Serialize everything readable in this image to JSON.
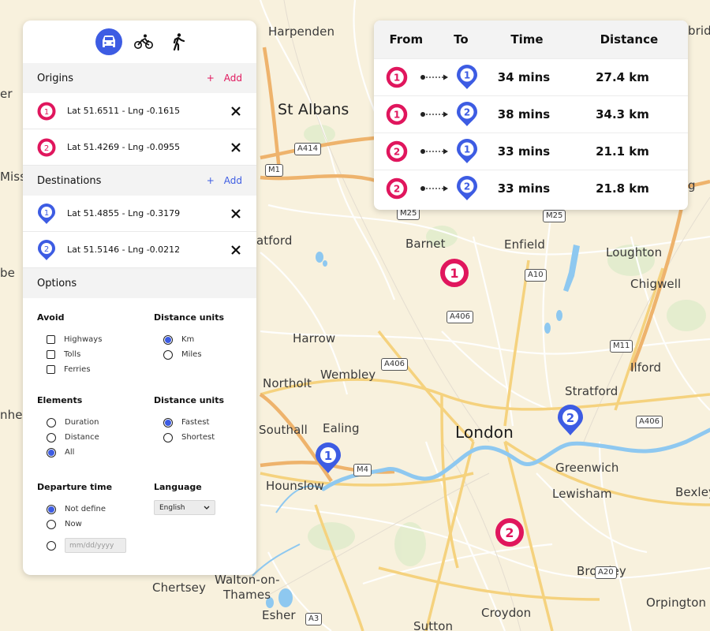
{
  "travel_modes": [
    {
      "name": "car",
      "icon": "car-icon",
      "active": true
    },
    {
      "name": "bicycle",
      "icon": "bicycle-icon",
      "active": false
    },
    {
      "name": "walking",
      "icon": "walking-icon",
      "active": false
    }
  ],
  "colors": {
    "origin": "#e0165d",
    "destination": "#3d5ce3",
    "accent": "#3d5ce3"
  },
  "origins": {
    "title": "Origins",
    "add_plus": "+",
    "add_label": "Add",
    "items": [
      {
        "number": "1",
        "label": "Lat 51.6511 - Lng -0.1615"
      },
      {
        "number": "2",
        "label": "Lat 51.4269 - Lng -0.0955"
      }
    ]
  },
  "destinations": {
    "title": "Destinations",
    "add_plus": "+",
    "add_label": "Add",
    "items": [
      {
        "number": "1",
        "label": "Lat 51.4855 - Lng -0.3179"
      },
      {
        "number": "2",
        "label": "Lat 51.5146 - Lng -0.0212"
      }
    ]
  },
  "options": {
    "title": "Options",
    "avoid": {
      "title": "Avoid",
      "items": [
        {
          "label": "Highways",
          "checked": false
        },
        {
          "label": "Tolls",
          "checked": false
        },
        {
          "label": "Ferries",
          "checked": false
        }
      ]
    },
    "distance_units": {
      "title": "Distance units",
      "items": [
        {
          "label": "Km",
          "selected": true
        },
        {
          "label": "Miles",
          "selected": false
        }
      ]
    },
    "elements": {
      "title": "Elements",
      "items": [
        {
          "label": "Duration",
          "selected": false
        },
        {
          "label": "Distance",
          "selected": false
        },
        {
          "label": "All",
          "selected": true
        }
      ]
    },
    "route_type": {
      "title": "Distance units",
      "items": [
        {
          "label": "Fastest",
          "selected": true
        },
        {
          "label": "Shortest",
          "selected": false
        }
      ]
    },
    "departure_time": {
      "title": "Departure time",
      "items": [
        {
          "label": "Not define",
          "selected": true
        },
        {
          "label": "Now",
          "selected": false
        }
      ],
      "date_placeholder": "mm/dd/yyyy",
      "date_selected": false
    },
    "language": {
      "title": "Language",
      "selected": "English"
    }
  },
  "results": {
    "headers": {
      "from": "From",
      "to": "To",
      "time": "Time",
      "distance": "Distance"
    },
    "rows": [
      {
        "from": "1",
        "to": "1",
        "time": "34 mins",
        "distance": "27.4 km"
      },
      {
        "from": "1",
        "to": "2",
        "time": "38 mins",
        "distance": "34.3 km"
      },
      {
        "from": "2",
        "to": "1",
        "time": "33 mins",
        "distance": "21.1 km"
      },
      {
        "from": "2",
        "to": "2",
        "time": "33 mins",
        "distance": "21.8 km"
      }
    ]
  },
  "map": {
    "places": [
      {
        "name": "Harpenden",
        "size": "normal"
      },
      {
        "name": "St Albans",
        "size": "big"
      },
      {
        "name": "Watford",
        "display": "atford",
        "size": "normal"
      },
      {
        "name": "Barnet",
        "size": "normal"
      },
      {
        "name": "Enfield",
        "size": "normal"
      },
      {
        "name": "Loughton",
        "size": "normal"
      },
      {
        "name": "Chigwell",
        "size": "normal"
      },
      {
        "name": "Harrow",
        "size": "normal"
      },
      {
        "name": "Wembley",
        "size": "normal"
      },
      {
        "name": "Northolt",
        "size": "normal"
      },
      {
        "name": "Ilford",
        "size": "normal"
      },
      {
        "name": "Stratford",
        "size": "normal"
      },
      {
        "name": "Southall",
        "size": "normal"
      },
      {
        "name": "Ealing",
        "size": "normal"
      },
      {
        "name": "London",
        "size": "xl"
      },
      {
        "name": "Hounslow",
        "size": "normal"
      },
      {
        "name": "Greenwich",
        "size": "normal"
      },
      {
        "name": "Lewisham",
        "size": "normal"
      },
      {
        "name": "Bexley",
        "size": "normal"
      },
      {
        "name": "Bromley",
        "size": "normal"
      },
      {
        "name": "Orpington",
        "size": "normal"
      },
      {
        "name": "Croydon",
        "size": "normal"
      },
      {
        "name": "Sutton",
        "size": "normal"
      },
      {
        "name": "Esher",
        "size": "normal"
      },
      {
        "name": "Walton-on-",
        "size": "normal"
      },
      {
        "name": "Thames",
        "size": "normal"
      },
      {
        "name": "Chertsey",
        "size": "normal"
      },
      {
        "name": "Hemel Hempstead",
        "display": "er",
        "size": "normal"
      },
      {
        "name": "Great Missenden",
        "display": "Misse",
        "size": "normal"
      },
      {
        "name": "Amersham",
        "display": "be",
        "size": "normal"
      },
      {
        "name": "Maidenhead",
        "display": "nhea",
        "size": "normal"
      },
      {
        "name": "Sawbridgeworth",
        "display": "bride",
        "size": "normal"
      },
      {
        "name": "Epping",
        "display": "g",
        "size": "normal"
      }
    ],
    "road_shields": [
      "A414",
      "M1",
      "M25",
      "M25",
      "A10",
      "A406",
      "A406",
      "M11",
      "A406",
      "M4",
      "A20",
      "A3"
    ],
    "markers": [
      {
        "type": "origin",
        "number": "1"
      },
      {
        "type": "origin",
        "number": "2"
      },
      {
        "type": "destination",
        "number": "1"
      },
      {
        "type": "destination",
        "number": "2"
      }
    ]
  }
}
